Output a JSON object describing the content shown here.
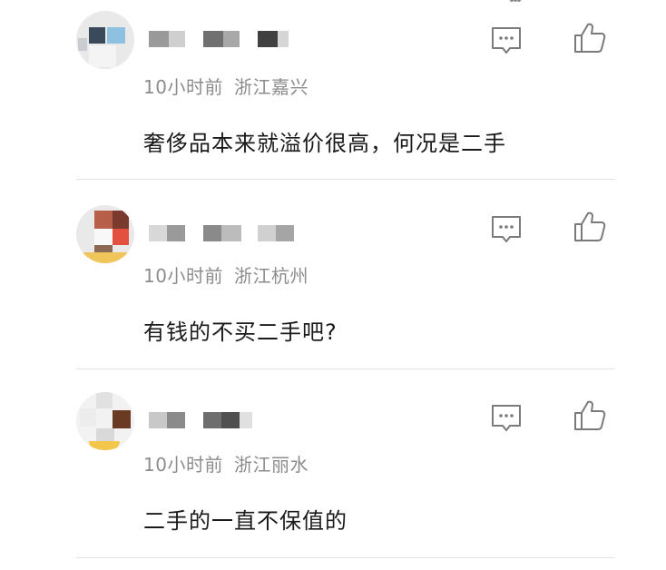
{
  "comments": [
    {
      "time": "10小时前",
      "location": "浙江嘉兴",
      "text": "奢侈品本来就溢价很高，何况是二手",
      "colors": {
        "avatar_a": "#3a4a5a",
        "avatar_b": "#8ec1e0",
        "avatar_c": "#c9ccd1"
      }
    },
    {
      "time": "10小时前",
      "location": "浙江杭州",
      "text": "有钱的不买二手吧?",
      "colors": {
        "avatar_a": "#b85f49",
        "avatar_b": "#e3503f",
        "avatar_c": "#f0c55a"
      }
    },
    {
      "time": "10小时前",
      "location": "浙江丽水",
      "text": "二手的一直不保值的",
      "colors": {
        "avatar_a": "#6b3a22",
        "avatar_b": "#d9d9d9",
        "avatar_c": "#f3c64c"
      }
    }
  ],
  "icons": {
    "reply": "comment-bubble-icon",
    "like": "thumbs-up-icon"
  }
}
